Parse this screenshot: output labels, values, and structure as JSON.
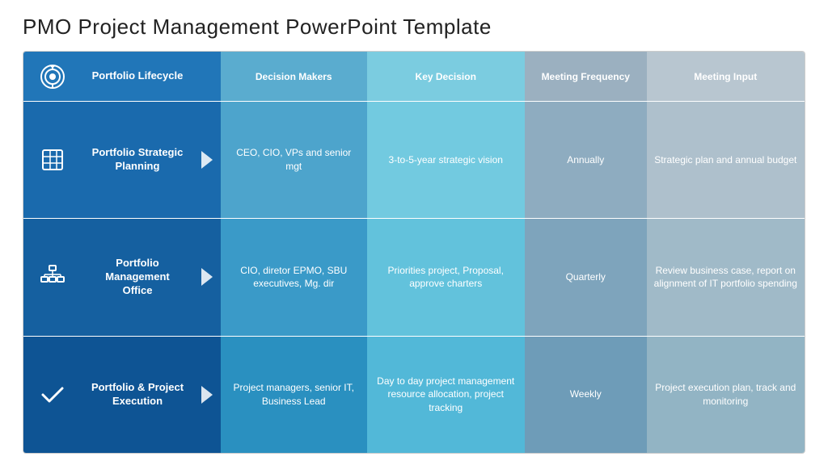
{
  "title": "PMO Project Management PowerPoint Template",
  "header": {
    "col_icon": "",
    "col_name": "Portfolio Lifecycle",
    "col_makers": "Decision Makers",
    "col_decision": "Key Decision",
    "col_freq": "Meeting Frequency",
    "col_input": "Meeting Input"
  },
  "rows": [
    {
      "id": "row1",
      "icon_type": "target",
      "name": "Portfolio Strategic Planning",
      "makers": "CEO, CIO, VPs and senior mgt",
      "decision": "3-to-5-year strategic vision",
      "freq": "Annually",
      "input": "Strategic plan and annual budget"
    },
    {
      "id": "row2",
      "icon_type": "org",
      "name": "Portfolio Management Office",
      "makers": "CIO, diretor EPMO, SBU executives, Mg. dir",
      "decision": "Priorities project, Proposal, approve charters",
      "freq": "Quarterly",
      "input": "Review business case, report on alignment of IT portfolio spending"
    },
    {
      "id": "row3",
      "icon_type": "check",
      "name": "Portfolio & Project Execution",
      "makers": "Project managers, senior IT, Business Lead",
      "decision": "Day to day project management resource allocation, project tracking",
      "freq": "Weekly",
      "input": "Project execution plan, track and monitoring"
    }
  ]
}
